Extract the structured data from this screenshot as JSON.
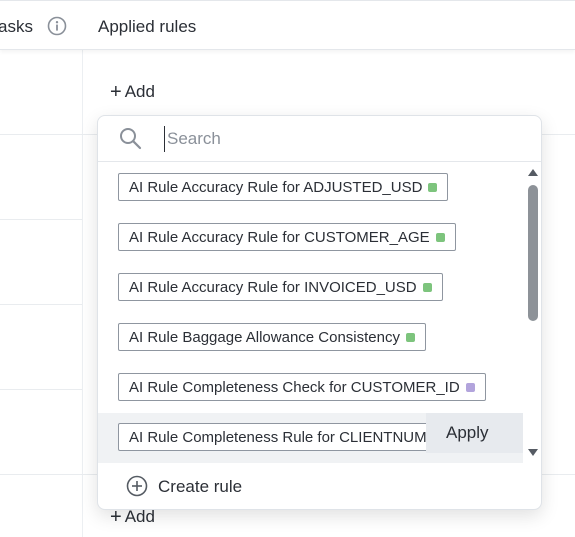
{
  "header": {
    "tasks_label": "asks",
    "rules_label": "Applied rules",
    "info_icon": "info-icon"
  },
  "cells": {
    "add_label": "Add",
    "plus_glyph": "+"
  },
  "dropdown": {
    "search": {
      "placeholder": "Search",
      "value": ""
    },
    "items": [
      {
        "label": "AI Rule Accuracy Rule for ADJUSTED_USD",
        "dot_color": "#7dc47d"
      },
      {
        "label": "AI Rule Accuracy Rule for CUSTOMER_AGE",
        "dot_color": "#7dc47d"
      },
      {
        "label": "AI Rule Accuracy Rule for INVOICED_USD",
        "dot_color": "#7dc47d"
      },
      {
        "label": "AI Rule Baggage Allowance Consistency",
        "dot_color": "#7dc47d"
      },
      {
        "label": "AI Rule Completeness Check for CUSTOMER_ID",
        "dot_color": "#b2a4dc"
      },
      {
        "label": "AI Rule Completeness Rule for CLIENTNUM",
        "dot_color": "#7dc47d"
      }
    ],
    "apply_label": "Apply",
    "create_label": "Create rule"
  }
}
